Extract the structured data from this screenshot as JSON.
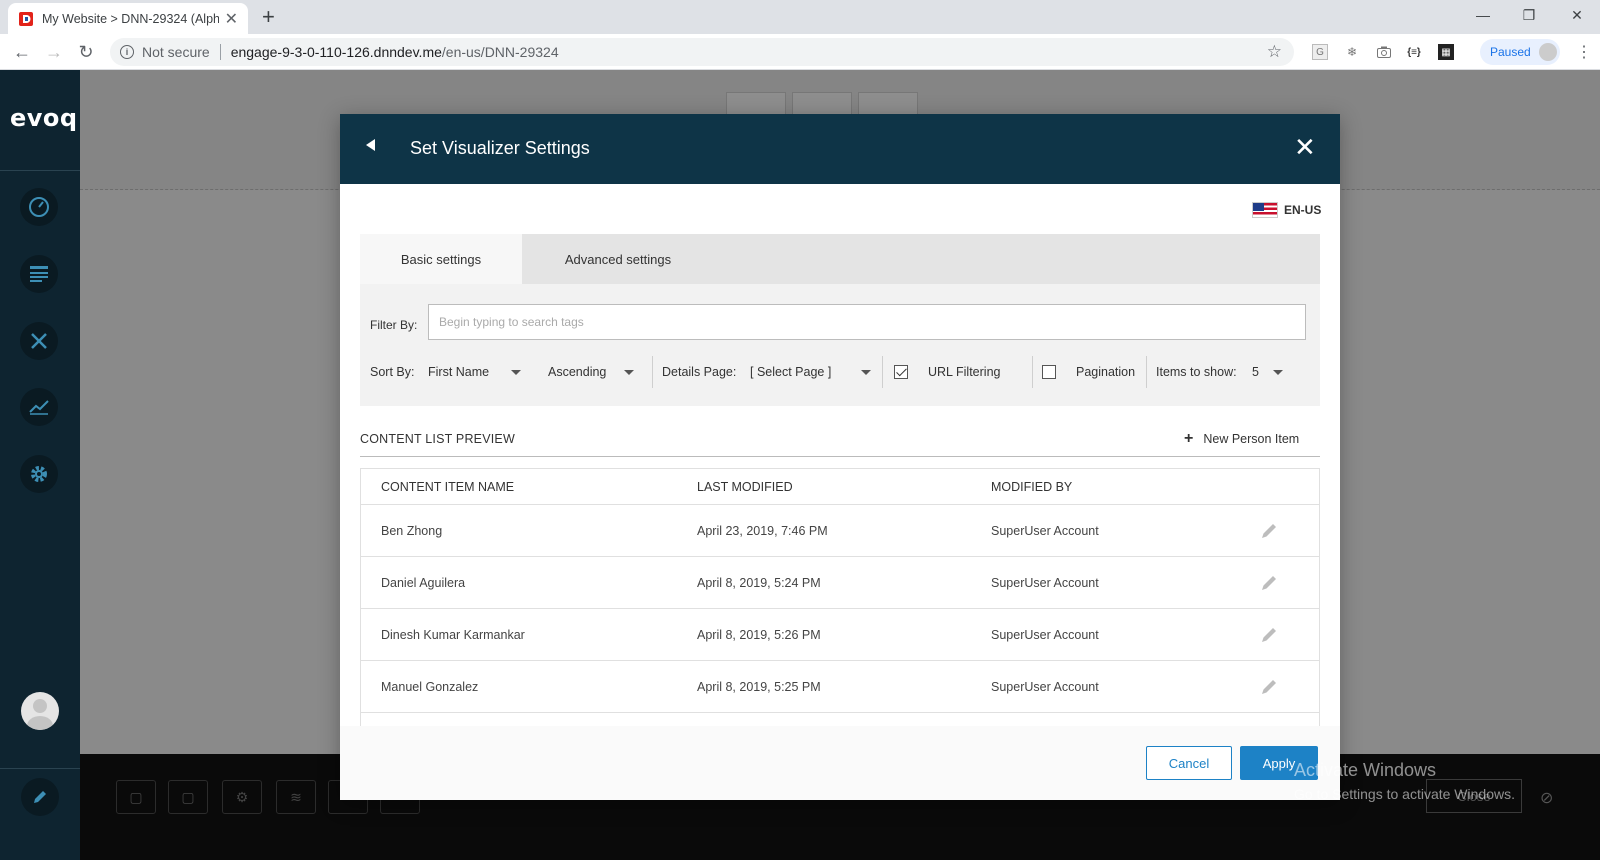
{
  "browser": {
    "tab_title": "My Website > DNN-29324 (Alph",
    "not_secure": "Not secure",
    "url_host": "engage-9-3-0-110-126.dnndev.me",
    "url_path": "/en-us/DNN-29324",
    "paused_label": "Paused"
  },
  "sidebar": {
    "logo": "evoq",
    "items": [
      "dashboard-icon",
      "content-icon",
      "tools-icon",
      "analytics-icon",
      "settings-icon"
    ]
  },
  "modal": {
    "title": "Set Visualizer Settings",
    "language": "EN-US",
    "tabs": [
      {
        "label": "Basic settings",
        "active": true
      },
      {
        "label": "Advanced settings",
        "active": false
      }
    ],
    "filter": {
      "label": "Filter By:",
      "placeholder": "Begin typing to search tags"
    },
    "sort": {
      "label": "Sort By:",
      "field": "First Name",
      "order": "Ascending",
      "details_label": "Details Page:",
      "details_value": "[ Select Page ]",
      "url_filtering_label": "URL Filtering",
      "url_filtering_checked": true,
      "pagination_label": "Pagination",
      "pagination_checked": false,
      "items_label": "Items to show:",
      "items_value": "5"
    },
    "preview": {
      "title": "CONTENT LIST PREVIEW",
      "new_item": "New Person Item",
      "columns": [
        "CONTENT ITEM NAME",
        "LAST MODIFIED",
        "MODIFIED BY"
      ],
      "rows": [
        {
          "name": "Ben Zhong",
          "modified": "April 23, 2019, 7:46 PM",
          "by": "SuperUser Account"
        },
        {
          "name": "Daniel Aguilera",
          "modified": "April 8, 2019, 5:24 PM",
          "by": "SuperUser Account"
        },
        {
          "name": "Dinesh Kumar Karmankar",
          "modified": "April 8, 2019, 5:26 PM",
          "by": "SuperUser Account"
        },
        {
          "name": "Manuel Gonzalez",
          "modified": "April 8, 2019, 5:25 PM",
          "by": "SuperUser Account"
        }
      ]
    },
    "footer": {
      "cancel": "Cancel",
      "apply": "Apply"
    }
  },
  "background": {
    "close_label": "Close",
    "watermark_title": "Activate Windows",
    "watermark_sub": "Go to Settings to activate Windows."
  },
  "colors": {
    "modal_header": "#0e3447",
    "sidebar": "#0e2430",
    "accent": "#1d82c6"
  }
}
